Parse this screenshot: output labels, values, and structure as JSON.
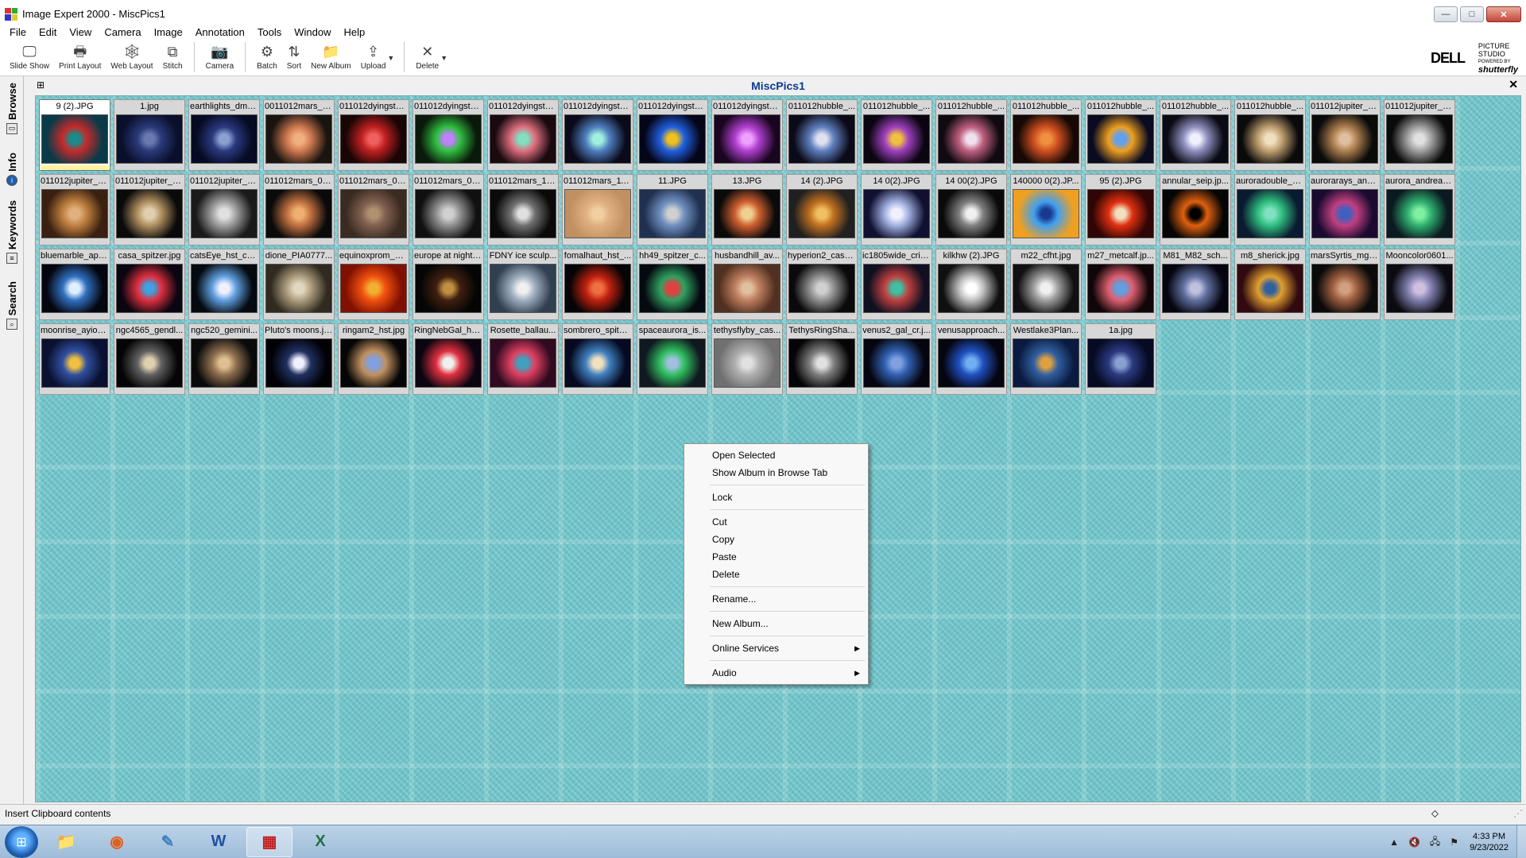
{
  "window": {
    "title": "Image Expert 2000 - MiscPics1",
    "min_symbol": "—",
    "max_symbol": "□",
    "close_symbol": "✕"
  },
  "menu": [
    "File",
    "Edit",
    "View",
    "Camera",
    "Image",
    "Annotation",
    "Tools",
    "Window",
    "Help"
  ],
  "toolbar": {
    "buttons": [
      {
        "label": "Slide Show",
        "icon": "slideshow-icon",
        "glyph": "🖵"
      },
      {
        "label": "Print Layout",
        "icon": "printer-icon",
        "glyph": "🖶"
      },
      {
        "label": "Web Layout",
        "icon": "web-layout-icon",
        "glyph": "🕸"
      },
      {
        "label": "Stitch",
        "icon": "stitch-icon",
        "glyph": "⧉"
      },
      {
        "label": "Camera",
        "icon": "camera-icon",
        "glyph": "📷"
      },
      {
        "label": "Batch",
        "icon": "batch-icon",
        "glyph": "⚙"
      },
      {
        "label": "Sort",
        "icon": "sort-icon",
        "glyph": "⇅"
      },
      {
        "label": "New Album",
        "icon": "new-album-icon",
        "glyph": "📁"
      },
      {
        "label": "Upload",
        "icon": "upload-icon",
        "glyph": "⇪"
      },
      {
        "label": "Delete",
        "icon": "delete-icon",
        "glyph": "✕"
      }
    ],
    "dropdown_glyph": "▼",
    "brand": {
      "word": "DELL",
      "line1": "PICTURE",
      "line2": "STUDIO",
      "powered": "POWERED BY",
      "partner": "shutterfly"
    }
  },
  "side_tabs": [
    {
      "label": "Browse",
      "icon": "browse-icon"
    },
    {
      "label": "Info",
      "icon": "info-icon"
    },
    {
      "label": "Keywords",
      "icon": "keywords-icon"
    },
    {
      "label": "Search",
      "icon": "search-icon"
    }
  ],
  "album": {
    "title": "MiscPics1",
    "pin_glyph": "⊞",
    "close_glyph": "✕"
  },
  "thumbnails": [
    {
      "name": "9 (2).JPG",
      "selected": true,
      "colors": [
        "#0a3a48",
        "#c62a2a",
        "#1a8a8a"
      ]
    },
    {
      "name": "1.jpg",
      "colors": [
        "#0a0f2a",
        "#2a3a7a",
        "#6a7ab0"
      ]
    },
    {
      "name": "earthlights_dms...",
      "colors": [
        "#060a22",
        "#2a3a80",
        "#8aa0d0"
      ]
    },
    {
      "name": "0011012mars_0...",
      "colors": [
        "#1a1410",
        "#d07a50",
        "#f0b080"
      ]
    },
    {
      "name": "011012dyingsta...",
      "colors": [
        "#1a0505",
        "#c02020",
        "#f06060"
      ]
    },
    {
      "name": "011012dyingsta...",
      "colors": [
        "#0a1a0a",
        "#30c040",
        "#c080ff"
      ]
    },
    {
      "name": "011012dyingsta...",
      "colors": [
        "#1a0a10",
        "#e07080",
        "#80e0c0"
      ]
    },
    {
      "name": "011012dyingsta...",
      "colors": [
        "#0a0a1a",
        "#5080c0",
        "#a0f0e0"
      ]
    },
    {
      "name": "011012dyingsta...",
      "colors": [
        "#05051a",
        "#2060e0",
        "#f0c020"
      ]
    },
    {
      "name": "011012dyingsta...",
      "colors": [
        "#1a0520",
        "#b040d0",
        "#f0a0ff"
      ]
    },
    {
      "name": "011012hubble_...",
      "colors": [
        "#0a0a18",
        "#6080c0",
        "#e0e0f0"
      ]
    },
    {
      "name": "011012hubble_...",
      "colors": [
        "#0a0510",
        "#a040c0",
        "#f0c040"
      ]
    },
    {
      "name": "011012hubble_...",
      "colors": [
        "#100a10",
        "#c06080",
        "#f0e0f0"
      ]
    },
    {
      "name": "011012hubble_...",
      "colors": [
        "#150805",
        "#d05020",
        "#f09040"
      ]
    },
    {
      "name": "011012hubble_...",
      "colors": [
        "#0a0a20",
        "#f0a020",
        "#60a0f0"
      ]
    },
    {
      "name": "011012hubble_...",
      "colors": [
        "#0a0a14",
        "#9090c0",
        "#f0f0ff"
      ]
    },
    {
      "name": "011012hubble_...",
      "colors": [
        "#0a0a0a",
        "#c0a070",
        "#f0e0c0"
      ]
    },
    {
      "name": "011012jupiter_0...",
      "colors": [
        "#0a0a0a",
        "#b08050",
        "#e0c0a0"
      ]
    },
    {
      "name": "011012jupiter_0...",
      "colors": [
        "#0a0a0a",
        "#a0a0a0",
        "#e0e0e0"
      ]
    },
    {
      "name": "011012jupiter_0...",
      "colors": [
        "#3a2010",
        "#c08040",
        "#e0b080"
      ]
    },
    {
      "name": "011012jupiter_0...",
      "colors": [
        "#0a0a0a",
        "#b09060",
        "#e0d0b0"
      ]
    },
    {
      "name": "011012jupiter_1...",
      "colors": [
        "#1a1a1a",
        "#a0a0a0",
        "#e0e0e0"
      ]
    },
    {
      "name": "011012mars_01...",
      "colors": [
        "#0a0a0a",
        "#c07040",
        "#f0b070"
      ]
    },
    {
      "name": "011012mars_08...",
      "colors": [
        "#3a2a20",
        "#806050",
        "#b09070"
      ]
    },
    {
      "name": "011012mars_09...",
      "colors": [
        "#101010",
        "#909090",
        "#d0d0d0"
      ]
    },
    {
      "name": "011012mars_10...",
      "colors": [
        "#0a0a0a",
        "#707070",
        "#e0e0e0"
      ]
    },
    {
      "name": "011012mars_11...",
      "colors": [
        "#c09060",
        "#e0b080",
        "#f0d0a0"
      ]
    },
    {
      "name": "11.JPG",
      "colors": [
        "#203050",
        "#7090c0",
        "#d0d0d0"
      ]
    },
    {
      "name": "13.JPG",
      "colors": [
        "#0a0a0a",
        "#d06030",
        "#f0d090"
      ]
    },
    {
      "name": "14 (2).JPG",
      "colors": [
        "#202020",
        "#c07020",
        "#f0c060"
      ]
    },
    {
      "name": "14 0(2).JPG",
      "colors": [
        "#101030",
        "#a0b0e0",
        "#f0f0ff"
      ]
    },
    {
      "name": "14 00(2).JPG",
      "colors": [
        "#0a0a0a",
        "#808080",
        "#f0f0f0"
      ]
    },
    {
      "name": "140000 0(2).JP...",
      "colors": [
        "#f0a020",
        "#40a0f0",
        "#1a3a90"
      ]
    },
    {
      "name": "95 (2).JPG",
      "colors": [
        "#300505",
        "#e03010",
        "#f0e0c0"
      ]
    },
    {
      "name": "annular_seip.jp...",
      "colors": [
        "#050505",
        "#e06010",
        "#000000"
      ]
    },
    {
      "name": "auroradouble_h...",
      "colors": [
        "#0a1a30",
        "#30c080",
        "#80e0c0"
      ]
    },
    {
      "name": "aurorarays_and...",
      "colors": [
        "#1a0a30",
        "#c04080",
        "#4060c0"
      ]
    },
    {
      "name": "aurora_andreas...",
      "colors": [
        "#0a1a20",
        "#30b070",
        "#80f0a0"
      ]
    },
    {
      "name": "bluemarble_apo...",
      "colors": [
        "#050510",
        "#3070c0",
        "#e0f0ff"
      ]
    },
    {
      "name": "casa_spitzer.jpg",
      "colors": [
        "#0a0510",
        "#e03040",
        "#40a0e0"
      ]
    },
    {
      "name": "catsEye_hst_c1...",
      "colors": [
        "#050a10",
        "#60a0e0",
        "#f0f0ff"
      ]
    },
    {
      "name": "dione_PIA0777...",
      "colors": [
        "#302a20",
        "#b0a080",
        "#e0d8c0"
      ]
    },
    {
      "name": "equinoxprom_ei...",
      "colors": [
        "#801000",
        "#f05010",
        "#f0b030"
      ]
    },
    {
      "name": "europe at night.j...",
      "colors": [
        "#050505",
        "#402010",
        "#c09040"
      ]
    },
    {
      "name": "FDNY ice sculp...",
      "colors": [
        "#304050",
        "#a0b0c0",
        "#f0f0f0"
      ]
    },
    {
      "name": "fomalhaut_hst_...",
      "colors": [
        "#050505",
        "#c02010",
        "#f07040"
      ]
    },
    {
      "name": "hh49_spitzer_c...",
      "colors": [
        "#050a10",
        "#30a060",
        "#e04040"
      ]
    },
    {
      "name": "husbandhill_av...",
      "colors": [
        "#503020",
        "#c08060",
        "#e0c0a0"
      ]
    },
    {
      "name": "hyperion2_cassi...",
      "colors": [
        "#0a0a0a",
        "#909090",
        "#d0d0d0"
      ]
    },
    {
      "name": "ic1805wide_cris...",
      "colors": [
        "#101020",
        "#c04040",
        "#40c0a0"
      ]
    },
    {
      "name": "kilkhw (2).JPG",
      "colors": [
        "#101010",
        "#c0c0c0",
        "#ffffff"
      ]
    },
    {
      "name": "m22_cfht.jpg",
      "colors": [
        "#101010",
        "#a0a0a0",
        "#f0f0f0"
      ]
    },
    {
      "name": "m27_metcalf.jp...",
      "colors": [
        "#100508",
        "#e06070",
        "#60a0e0"
      ]
    },
    {
      "name": "M81_M82_sch...",
      "colors": [
        "#050510",
        "#6070a0",
        "#c0c0e0"
      ]
    },
    {
      "name": "m8_sherick.jpg",
      "colors": [
        "#300a10",
        "#e0a030",
        "#3060a0"
      ]
    },
    {
      "name": "marsSyrtis_mgs...",
      "colors": [
        "#0a0a0a",
        "#a06040",
        "#d0a080"
      ]
    },
    {
      "name": "Mooncolor0601...",
      "colors": [
        "#0a0a10",
        "#8080b0",
        "#d0c0e0"
      ]
    },
    {
      "name": "moonrise_ayiom...",
      "colors": [
        "#0a1030",
        "#3050a0",
        "#f0c040"
      ]
    },
    {
      "name": "ngc4565_gendl...",
      "colors": [
        "#050505",
        "#606060",
        "#e0d0b0"
      ]
    },
    {
      "name": "ngc520_gemini...",
      "colors": [
        "#0a0a0a",
        "#907050",
        "#e0c090"
      ]
    },
    {
      "name": "Pluto's moons.jp...",
      "colors": [
        "#000005",
        "#203060",
        "#f0f0ff"
      ]
    },
    {
      "name": "ringam2_hst.jpg",
      "colors": [
        "#050505",
        "#c09060",
        "#80a0e0"
      ]
    },
    {
      "name": "RingNebGal_ha...",
      "colors": [
        "#0a0510",
        "#e03040",
        "#f0f0f0"
      ]
    },
    {
      "name": "Rosette_ballau...",
      "colors": [
        "#300a20",
        "#e04060",
        "#40a0c0"
      ]
    },
    {
      "name": "sombrero_spitze...",
      "colors": [
        "#050a20",
        "#4080c0",
        "#f0e0c0"
      ]
    },
    {
      "name": "spaceaurora_is...",
      "colors": [
        "#101820",
        "#30c060",
        "#a0c0e0"
      ]
    },
    {
      "name": "tethysflyby_cas...",
      "colors": [
        "#707070",
        "#b0b0b0",
        "#e0e0e0"
      ]
    },
    {
      "name": "TethysRingSha...",
      "colors": [
        "#050505",
        "#808080",
        "#e0e0e0"
      ]
    },
    {
      "name": "venus2_gal_cr.j...",
      "colors": [
        "#050510",
        "#3060b0",
        "#80a0e0"
      ]
    },
    {
      "name": "venusapproach...",
      "colors": [
        "#050510",
        "#2050c0",
        "#70b0f0"
      ]
    },
    {
      "name": "Westlake3Plan...",
      "colors": [
        "#0a1a40",
        "#3060a0",
        "#e0a040"
      ]
    },
    {
      "name": "1a.jpg",
      "colors": [
        "#060a22",
        "#2a3a80",
        "#8aa0d0"
      ]
    }
  ],
  "context_menu": [
    {
      "type": "item",
      "label": "Open Selected"
    },
    {
      "type": "item",
      "label": "Show Album in Browse Tab"
    },
    {
      "type": "sep"
    },
    {
      "type": "item",
      "label": "Lock"
    },
    {
      "type": "sep"
    },
    {
      "type": "item",
      "label": "Cut"
    },
    {
      "type": "item",
      "label": "Copy"
    },
    {
      "type": "item",
      "label": "Paste"
    },
    {
      "type": "item",
      "label": "Delete"
    },
    {
      "type": "sep"
    },
    {
      "type": "item",
      "label": "Rename..."
    },
    {
      "type": "sep"
    },
    {
      "type": "item",
      "label": "New Album..."
    },
    {
      "type": "sep"
    },
    {
      "type": "item",
      "label": "Online Services",
      "submenu": true
    },
    {
      "type": "sep"
    },
    {
      "type": "item",
      "label": "Audio",
      "submenu": true
    }
  ],
  "context_menu_arrow": "▶",
  "status": {
    "text": "Insert Clipboard contents"
  },
  "taskbar": {
    "start_glyph": "⊞",
    "apps": [
      {
        "name": "explorer",
        "glyph": "📁",
        "color": "#e0b040"
      },
      {
        "name": "firefox",
        "glyph": "◉",
        "color": "#e06020"
      },
      {
        "name": "paint",
        "glyph": "✎",
        "color": "#4080c0"
      },
      {
        "name": "word",
        "glyph": "W",
        "color": "#2050a0"
      },
      {
        "name": "image-expert",
        "glyph": "▦",
        "color": "#c02020",
        "active": true
      },
      {
        "name": "excel",
        "glyph": "X",
        "color": "#207040"
      }
    ],
    "tray_glyphs": [
      "▲",
      "🔇",
      "🖧",
      "⚑"
    ],
    "time": "4:33 PM",
    "date": "9/23/2022"
  }
}
